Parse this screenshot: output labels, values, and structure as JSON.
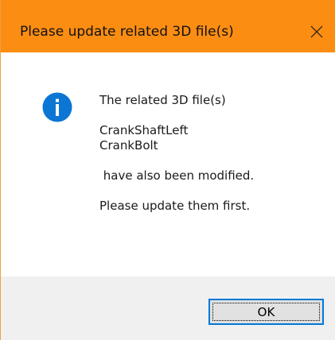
{
  "dialog": {
    "title": "Please update related 3D file(s)",
    "close_icon": "close-icon",
    "accent_color": "#fc8d13"
  },
  "message": {
    "icon": "info-icon",
    "icon_color": "#0b76d4",
    "line1": "The related 3D file(s)",
    "files": [
      "CrankShaftLeft",
      "CrankBolt"
    ],
    "line2": " have also been modified.",
    "line3": "Please update them first."
  },
  "buttons": {
    "ok_label": "OK"
  }
}
